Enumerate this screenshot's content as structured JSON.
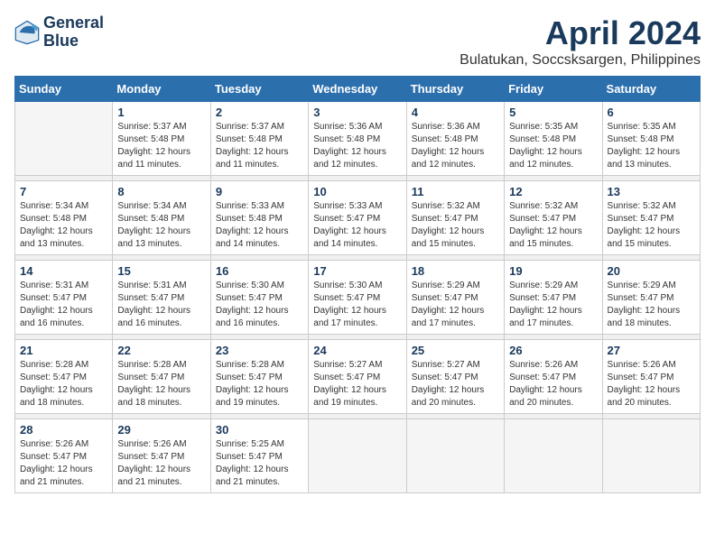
{
  "header": {
    "logo_line1": "General",
    "logo_line2": "Blue",
    "title": "April 2024",
    "subtitle": "Bulatukan, Soccsksargen, Philippines"
  },
  "days_of_week": [
    "Sunday",
    "Monday",
    "Tuesday",
    "Wednesday",
    "Thursday",
    "Friday",
    "Saturday"
  ],
  "weeks": [
    [
      {
        "day": "",
        "info": ""
      },
      {
        "day": "1",
        "info": "Sunrise: 5:37 AM\nSunset: 5:48 PM\nDaylight: 12 hours\nand 11 minutes."
      },
      {
        "day": "2",
        "info": "Sunrise: 5:37 AM\nSunset: 5:48 PM\nDaylight: 12 hours\nand 11 minutes."
      },
      {
        "day": "3",
        "info": "Sunrise: 5:36 AM\nSunset: 5:48 PM\nDaylight: 12 hours\nand 12 minutes."
      },
      {
        "day": "4",
        "info": "Sunrise: 5:36 AM\nSunset: 5:48 PM\nDaylight: 12 hours\nand 12 minutes."
      },
      {
        "day": "5",
        "info": "Sunrise: 5:35 AM\nSunset: 5:48 PM\nDaylight: 12 hours\nand 12 minutes."
      },
      {
        "day": "6",
        "info": "Sunrise: 5:35 AM\nSunset: 5:48 PM\nDaylight: 12 hours\nand 13 minutes."
      }
    ],
    [
      {
        "day": "7",
        "info": "Sunrise: 5:34 AM\nSunset: 5:48 PM\nDaylight: 12 hours\nand 13 minutes."
      },
      {
        "day": "8",
        "info": "Sunrise: 5:34 AM\nSunset: 5:48 PM\nDaylight: 12 hours\nand 13 minutes."
      },
      {
        "day": "9",
        "info": "Sunrise: 5:33 AM\nSunset: 5:48 PM\nDaylight: 12 hours\nand 14 minutes."
      },
      {
        "day": "10",
        "info": "Sunrise: 5:33 AM\nSunset: 5:47 PM\nDaylight: 12 hours\nand 14 minutes."
      },
      {
        "day": "11",
        "info": "Sunrise: 5:32 AM\nSunset: 5:47 PM\nDaylight: 12 hours\nand 15 minutes."
      },
      {
        "day": "12",
        "info": "Sunrise: 5:32 AM\nSunset: 5:47 PM\nDaylight: 12 hours\nand 15 minutes."
      },
      {
        "day": "13",
        "info": "Sunrise: 5:32 AM\nSunset: 5:47 PM\nDaylight: 12 hours\nand 15 minutes."
      }
    ],
    [
      {
        "day": "14",
        "info": "Sunrise: 5:31 AM\nSunset: 5:47 PM\nDaylight: 12 hours\nand 16 minutes."
      },
      {
        "day": "15",
        "info": "Sunrise: 5:31 AM\nSunset: 5:47 PM\nDaylight: 12 hours\nand 16 minutes."
      },
      {
        "day": "16",
        "info": "Sunrise: 5:30 AM\nSunset: 5:47 PM\nDaylight: 12 hours\nand 16 minutes."
      },
      {
        "day": "17",
        "info": "Sunrise: 5:30 AM\nSunset: 5:47 PM\nDaylight: 12 hours\nand 17 minutes."
      },
      {
        "day": "18",
        "info": "Sunrise: 5:29 AM\nSunset: 5:47 PM\nDaylight: 12 hours\nand 17 minutes."
      },
      {
        "day": "19",
        "info": "Sunrise: 5:29 AM\nSunset: 5:47 PM\nDaylight: 12 hours\nand 17 minutes."
      },
      {
        "day": "20",
        "info": "Sunrise: 5:29 AM\nSunset: 5:47 PM\nDaylight: 12 hours\nand 18 minutes."
      }
    ],
    [
      {
        "day": "21",
        "info": "Sunrise: 5:28 AM\nSunset: 5:47 PM\nDaylight: 12 hours\nand 18 minutes."
      },
      {
        "day": "22",
        "info": "Sunrise: 5:28 AM\nSunset: 5:47 PM\nDaylight: 12 hours\nand 18 minutes."
      },
      {
        "day": "23",
        "info": "Sunrise: 5:28 AM\nSunset: 5:47 PM\nDaylight: 12 hours\nand 19 minutes."
      },
      {
        "day": "24",
        "info": "Sunrise: 5:27 AM\nSunset: 5:47 PM\nDaylight: 12 hours\nand 19 minutes."
      },
      {
        "day": "25",
        "info": "Sunrise: 5:27 AM\nSunset: 5:47 PM\nDaylight: 12 hours\nand 20 minutes."
      },
      {
        "day": "26",
        "info": "Sunrise: 5:26 AM\nSunset: 5:47 PM\nDaylight: 12 hours\nand 20 minutes."
      },
      {
        "day": "27",
        "info": "Sunrise: 5:26 AM\nSunset: 5:47 PM\nDaylight: 12 hours\nand 20 minutes."
      }
    ],
    [
      {
        "day": "28",
        "info": "Sunrise: 5:26 AM\nSunset: 5:47 PM\nDaylight: 12 hours\nand 21 minutes."
      },
      {
        "day": "29",
        "info": "Sunrise: 5:26 AM\nSunset: 5:47 PM\nDaylight: 12 hours\nand 21 minutes."
      },
      {
        "day": "30",
        "info": "Sunrise: 5:25 AM\nSunset: 5:47 PM\nDaylight: 12 hours\nand 21 minutes."
      },
      {
        "day": "",
        "info": ""
      },
      {
        "day": "",
        "info": ""
      },
      {
        "day": "",
        "info": ""
      },
      {
        "day": "",
        "info": ""
      }
    ]
  ]
}
